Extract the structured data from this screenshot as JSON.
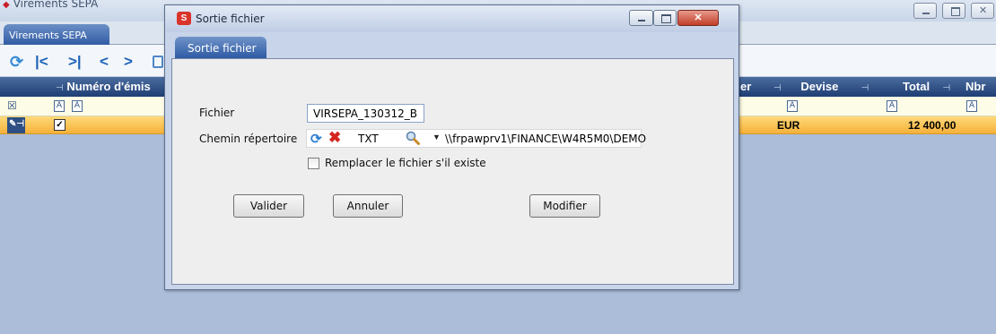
{
  "app": {
    "title": "Virements SEPA",
    "tab": "Virements SEPA",
    "grid": {
      "columns": [
        "Numéro d'émis",
        "er",
        "Devise",
        "Total",
        "Nbr"
      ],
      "filter_icon_glyph": "A",
      "row": {
        "devise": "EUR",
        "total": "12 400,00"
      }
    }
  },
  "dialog": {
    "title": "Sortie fichier",
    "tab": "Sortie fichier",
    "labels": {
      "fichier": "Fichier",
      "chemin": "Chemin répertoire",
      "replace": "Remplacer le fichier s'il existe"
    },
    "fichier_value": "VIRSEPA_130312_B",
    "path": {
      "ext": "TXT",
      "directory": "\\\\frpawprv1\\FINANCE\\W4R5M0\\DEMO"
    },
    "replace_checked": false,
    "buttons": {
      "valider": "Valider",
      "annuler": "Annuler",
      "modifier": "Modifier"
    }
  }
}
